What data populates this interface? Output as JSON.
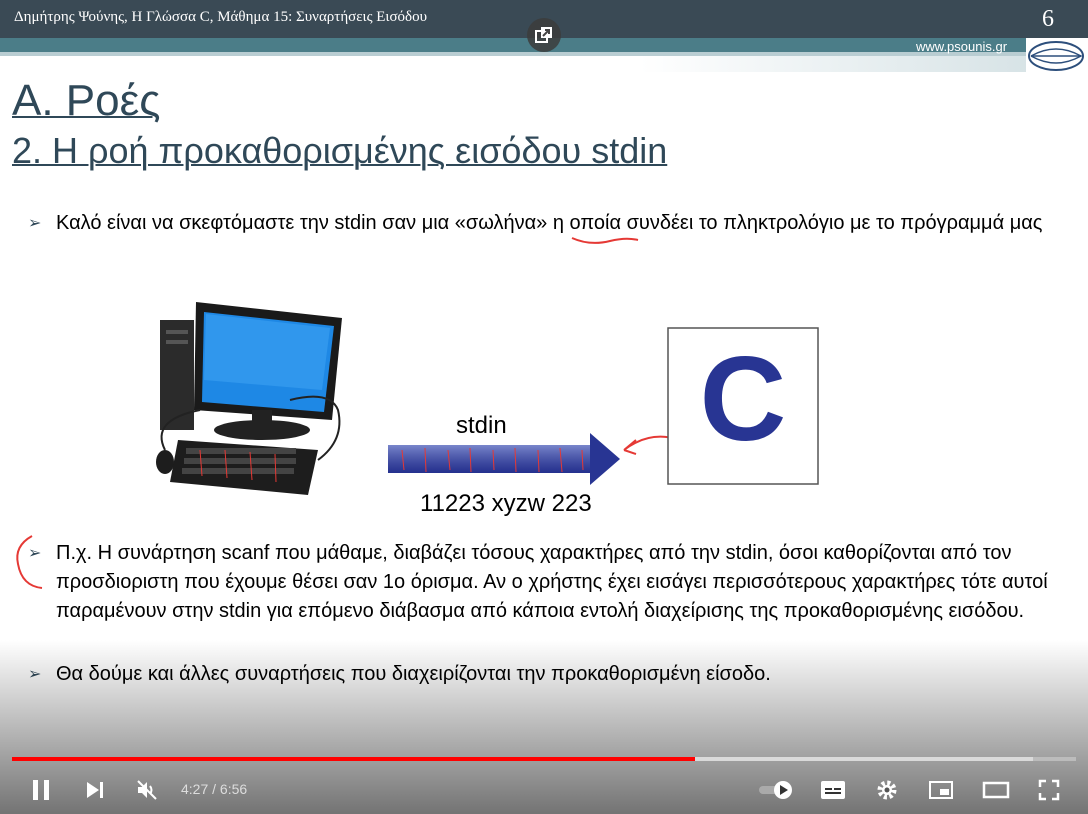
{
  "slide": {
    "header_title": "Δημήτρης Ψούνης, Η Γλώσσα C, Μάθημα 15: Συναρτήσεις Εισόδου",
    "slide_number": "6",
    "website": "www.psounis.gr",
    "heading": "Α. Ροές",
    "subheading": "2. Η ροή προκαθορισμένης εισόδου stdin",
    "bullets": [
      "Καλό είναι να σκεφτόμαστε την stdin σαν μια «σωλήνα» η οποία συνδέει το πληκτρολόγιο με το πρόγραμμά μας",
      "Π.χ. Η συνάρτηση scanf που μάθαμε, διαβάζει τόσους χαρακτήρες από την stdin, όσοι καθορίζονται από τον προσδιοριστη που έχουμε θέσει σαν 1ο όρισμα. Αν ο χρήστης έχει εισάγει περισσότερους χαρακτήρες τότε αυτοί παραμένουν στην stdin για επόμενο διάβασμα από κάποια εντολή διαχείρισης της προκαθορισμένης εισόδου.",
      "Θα δούμε και άλλες συναρτήσεις που διαχειρίζονται την προκαθορισμένη είσοδο."
    ],
    "diagram": {
      "stream_label": "stdin",
      "input_example": "11223 xyzw 223",
      "program_letter": "C"
    }
  },
  "player": {
    "current_time": "4:27",
    "duration": "6:56",
    "time_display": "4:27 / 6:56",
    "played_fraction": 0.642,
    "loaded_fraction": 0.96,
    "controls": [
      "pause-icon",
      "next-icon",
      "mute-icon",
      "autoplay-toggle",
      "subtitles-icon",
      "settings-icon",
      "miniplayer-icon",
      "theater-icon",
      "fullscreen-icon"
    ],
    "accent": "#ff0000"
  }
}
